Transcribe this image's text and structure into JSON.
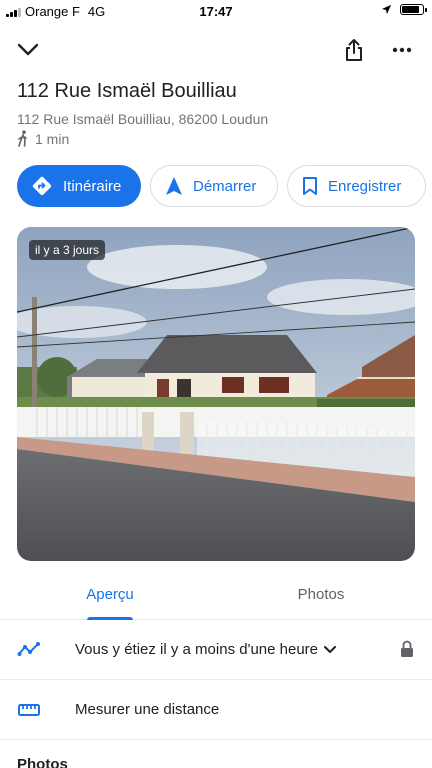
{
  "status_bar": {
    "carrier": "Orange F",
    "network": "4G",
    "time": "17:47",
    "battery_level": 0.85
  },
  "topbar": {
    "collapse_icon": "chevron-down-icon",
    "share_icon": "share-icon",
    "more_icon": "more-vert-icon"
  },
  "place": {
    "title": "112 Rue Ismaël Bouilliau",
    "address": "112 Rue Ismaël Bouilliau, 86200 Loudun",
    "walk_time": "1 min"
  },
  "actions": {
    "directions_label": "Itinéraire",
    "start_label": "Démarrer",
    "save_label": "Enregistrer"
  },
  "photo": {
    "badge": "il y a 3 jours"
  },
  "tabs": [
    {
      "label": "Aperçu",
      "active": true
    },
    {
      "label": "Photos",
      "active": false
    }
  ],
  "rows": {
    "visited": "Vous y étiez il y a moins d'une heure",
    "measure": "Mesurer une distance"
  },
  "section": {
    "photos_heading": "Photos"
  },
  "colors": {
    "accent": "#1a73e8",
    "text": "#202124",
    "secondary_text": "#70757a"
  }
}
